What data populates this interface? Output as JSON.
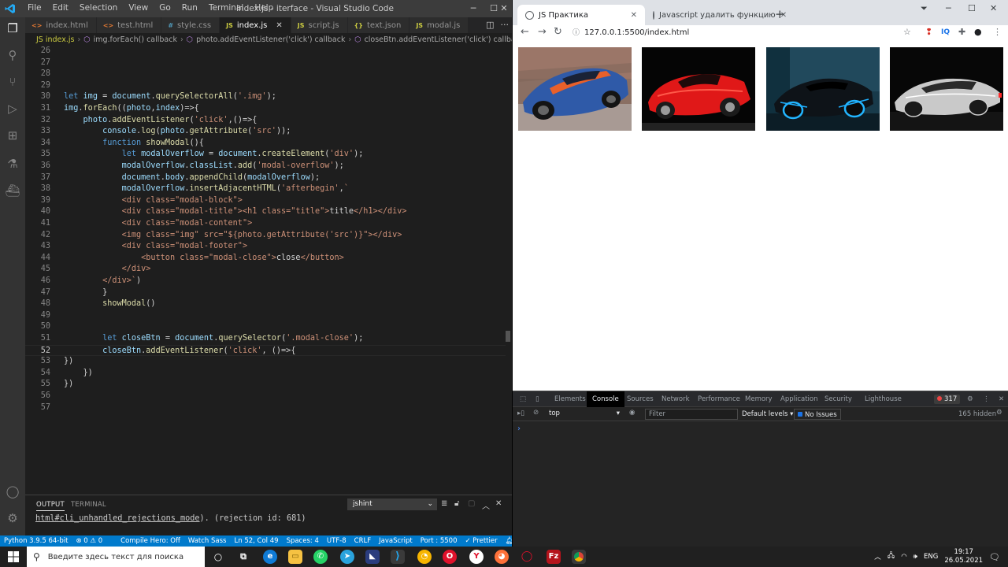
{
  "vscode": {
    "menu": [
      "File",
      "Edit",
      "Selection",
      "View",
      "Go",
      "Run",
      "Terminal",
      "Help"
    ],
    "window_title": "index.js - iterface - Visual Studio Code",
    "tabs": [
      {
        "icon": "<>",
        "label": "index.html"
      },
      {
        "icon": "<>",
        "label": "test.html"
      },
      {
        "icon": "#",
        "label": "style.css"
      },
      {
        "icon": "JS",
        "label": "index.js",
        "active": true
      },
      {
        "icon": "JS",
        "label": "script.js"
      },
      {
        "icon": "{}",
        "label": "text.json"
      },
      {
        "icon": "JS",
        "label": "modal.js"
      }
    ],
    "breadcrumb": [
      "JS index.js",
      "img.forEach() callback",
      "photo.addEventListener('click') callback",
      "closeBtn.addEventListener('click') callback"
    ],
    "code_lines": [
      {
        "n": "26",
        "t": ""
      },
      {
        "n": "27",
        "t": ""
      },
      {
        "n": "28",
        "t": ""
      },
      {
        "n": "29",
        "t": ""
      },
      {
        "n": "30",
        "t": "let img = document.querySelectorAll('.img');"
      },
      {
        "n": "31",
        "t": "img.forEach((photo,index)=>{"
      },
      {
        "n": "32",
        "t": "    photo.addEventListener('click',()=>{"
      },
      {
        "n": "33",
        "t": "        console.log(photo.getAttribute('src'));"
      },
      {
        "n": "34",
        "t": "        function showModal(){"
      },
      {
        "n": "35",
        "t": "            let modalOverflow = document.createElement('div');"
      },
      {
        "n": "36",
        "t": "            modalOverflow.classList.add('modal-overflow');"
      },
      {
        "n": "37",
        "t": "            document.body.appendChild(modalOverflow);"
      },
      {
        "n": "38",
        "t": "            modalOverflow.insertAdjacentHTML('afterbegin',`"
      },
      {
        "n": "39",
        "t": "            <div class=\"modal-block\">"
      },
      {
        "n": "40",
        "t": "            <div class=\"modal-title\"><h1 class=\"title\">title</h1></div>"
      },
      {
        "n": "41",
        "t": "            <div class=\"modal-content\">"
      },
      {
        "n": "42",
        "t": "            <img class=\"img\" src=\"${photo.getAttribute('src')}\"></div>"
      },
      {
        "n": "43",
        "t": "            <div class=\"modal-footer\">"
      },
      {
        "n": "44",
        "t": "                <button class=\"modal-close\">close</button>"
      },
      {
        "n": "45",
        "t": "            </div>"
      },
      {
        "n": "46",
        "t": "        </div>`)"
      },
      {
        "n": "47",
        "t": "        }"
      },
      {
        "n": "48",
        "t": "        showModal()"
      },
      {
        "n": "49",
        "t": ""
      },
      {
        "n": "50",
        "t": ""
      },
      {
        "n": "51",
        "t": "        let closeBtn = document.querySelector('.modal-close');"
      },
      {
        "n": "52",
        "t": "        closeBtn.addEventListener('click', ()=>{"
      },
      {
        "n": "53",
        "t": "})"
      },
      {
        "n": "54",
        "t": "    })"
      },
      {
        "n": "55",
        "t": "})"
      },
      {
        "n": "56",
        "t": ""
      },
      {
        "n": "57",
        "t": ""
      }
    ],
    "panel": {
      "tabs": [
        "OUTPUT",
        "TERMINAL"
      ],
      "select_value": "jshint",
      "output_link": "html#cli_unhandled_rejections_mode",
      "output_rest": "). (rejection id: 681)"
    },
    "status": [
      "Python 3.9.5 64-bit",
      "⊗ 0 ⚠ 0",
      "Compile Hero: Off",
      "Watch Sass",
      "Ln 52, Col 49",
      "Spaces: 4",
      "UTF-8",
      "CRLF",
      "JavaScript",
      "Port : 5500",
      "✓ Prettier"
    ]
  },
  "chrome": {
    "tabs": [
      {
        "label": "JS Практика",
        "active": true
      },
      {
        "label": "Javascript удалить функцию",
        "active": false
      }
    ],
    "url": "127.0.0.1:5500/index.html",
    "devtools": {
      "tabs": [
        "Elements",
        "Console",
        "Sources",
        "Network",
        "Performance",
        "Memory",
        "Application",
        "Security",
        "Lighthouse"
      ],
      "error_count": "317",
      "context": "top",
      "filter_placeholder": "Filter",
      "levels": "Default levels",
      "issues": "No Issues",
      "hidden": "165 hidden",
      "prompt": "›"
    }
  },
  "taskbar": {
    "search_placeholder": "Введите здесь текст для поиска",
    "lang": "ENG",
    "time": "19:17",
    "date": "26.05.2021"
  }
}
